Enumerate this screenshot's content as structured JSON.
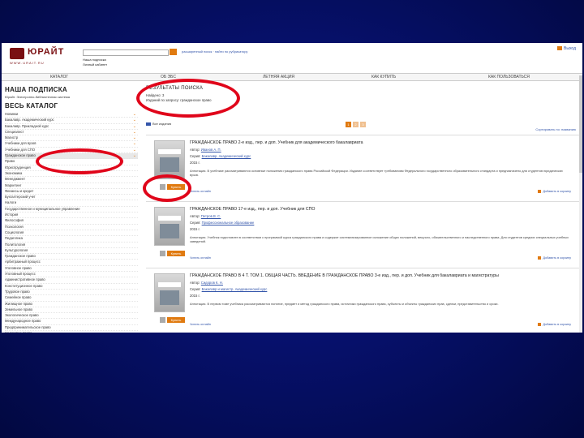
{
  "header": {
    "logo_name": "ЮРАЙТ",
    "logo_sub": "WWW.URAIT.RU",
    "search_options": [
      "расширенный поиск",
      "найти по рубрикатору"
    ],
    "links": [
      "Наша подписка",
      "Личный кабинет"
    ],
    "login": "Выход"
  },
  "nav": [
    "КАТАЛОГ",
    "ОБ ЭБС",
    "ЛЕТНЯЯ АКЦИЯ",
    "КАК КУПИТЬ",
    "КАК ПОЛЬЗОВАТЬСЯ"
  ],
  "sidebar": {
    "subscription_title": "НАША ПОДПИСКА",
    "subscription_text": "Юрайт. Электронно-библиотечная система",
    "catalog_title": "ВЕСЬ КАТАЛОГ",
    "items": [
      "Новинки",
      "Бакалавр. Академический курс",
      "Бакалавр. Прикладной курс",
      "Специалист",
      "Магистр",
      "Учебники для вузов",
      "Учебники для СПО",
      "Гражданское право",
      "Право",
      "Юриспруденция",
      "Экономика",
      "Менеджмент",
      "Маркетинг",
      "Финансы и кредит",
      "Бухгалтерский учет",
      "Налоги",
      "Государственное и муниципальное управление",
      "История",
      "Философия",
      "Психология",
      "Социология",
      "Педагогика",
      "Политология",
      "Культурология",
      "Гражданское право",
      "Арбитражный процесс",
      "Уголовное право",
      "Уголовный процесс",
      "Административное право",
      "Конституционное право",
      "Трудовое право",
      "Семейное право",
      "Жилищное право",
      "Земельное право",
      "Экологическое право",
      "Международное право",
      "Предпринимательское право",
      "Налоговое право",
      "Финансовое право",
      "Банковское право",
      "Нотариат",
      "Судебная экспертиза"
    ]
  },
  "main": {
    "title": "РЕЗУЛЬТАТЫ ПОИСКА",
    "found_lines": [
      "Найдено: 3",
      "Изданий по запросу: гражданское право"
    ],
    "pager": [
      "1",
      "2",
      "3"
    ],
    "filter_label": "Все издания",
    "sort_label": "Сортировать по: названию",
    "sort_options": [
      "по названию",
      "по дате",
      "по цене"
    ],
    "books": [
      {
        "title": "ГРАЖДАНСКОЕ ПРАВО 2-е изд., пер. и доп. Учебник для академического бакалавриата",
        "author_label": "Автор:",
        "author": "Иванов А. П.",
        "series_label": "Серия:",
        "series": "Бакалавр. Академический курс",
        "year": "2015 г.",
        "desc": "Аннотация. В учебнике рассматриваются основные положения гражданского права Российской Федерации. Издание соответствует требованиям Федерального государственного образовательного стандарта и предназначено для студентов юридических вузов.",
        "buy": "Купить",
        "foot_left": "Читать онлайн",
        "foot_right": "Добавить в корзину"
      },
      {
        "title": "ГРАЖДАНСКОЕ ПРАВО 17-е изд., пер. и доп. Учебник для СПО",
        "author_label": "Автор:",
        "author": "Петров В. С.",
        "series_label": "Серия:",
        "series": "Профессиональное образование",
        "year": "2015 г.",
        "desc": "Аннотация. Учебник подготовлен в соответствии с программой курса гражданского права и содержит систематизированное изложение общих положений, вещного, обязательственного и наследственного права. Для студентов средних специальных учебных заведений.",
        "buy": "Купить",
        "foot_left": "Читать онлайн",
        "foot_right": "Добавить в корзину"
      },
      {
        "title": "ГРАЖДАНСКОЕ ПРАВО В 4 Т. ТОМ 1. ОБЩАЯ ЧАСТЬ. ВВЕДЕНИЕ В ГРАЖДАНСКОЕ ПРАВО 3-е изд., пер. и доп. Учебник для бакалавриата и магистратуры",
        "author_label": "Автор:",
        "author": "Сидоров К. Н.",
        "series_label": "Серия:",
        "series": "Бакалавр и магистр. Академический курс",
        "year": "2015 г.",
        "desc": "Аннотация. В первом томе учебника рассматриваются понятие, предмет и метод гражданского права, источники гражданского права, субъекты и объекты гражданских прав, сделки, представительство и сроки.",
        "buy": "Купить",
        "foot_left": "Читать онлайн",
        "foot_right": "Добавить в корзину"
      }
    ]
  },
  "colors": {
    "accent": "#e07a10",
    "annotation": "#e0051a",
    "brand": "#7a0f12"
  }
}
